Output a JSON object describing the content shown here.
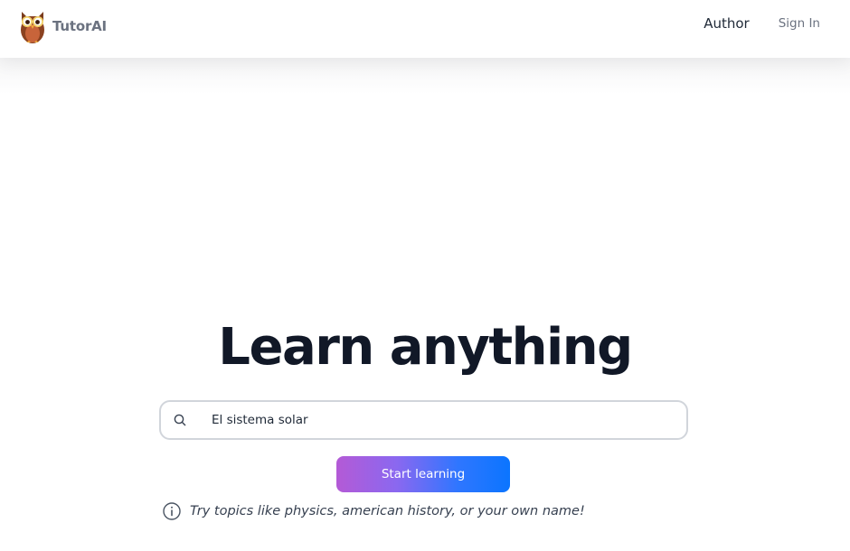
{
  "header": {
    "brand_name": "TutorAI",
    "logo_icon": "owl-logo-icon",
    "nav": {
      "author": "Author",
      "sign_in": "Sign In"
    }
  },
  "hero": {
    "title": "Learn anything"
  },
  "search": {
    "icon": "search-icon",
    "value": "El sistema solar"
  },
  "start_button": {
    "label": "Start learning",
    "gradient_from": "#b45ad6",
    "gradient_to": "#0b75ff"
  },
  "hint": {
    "icon": "info-icon",
    "text": "Try topics like physics, american history, or your own name!"
  }
}
